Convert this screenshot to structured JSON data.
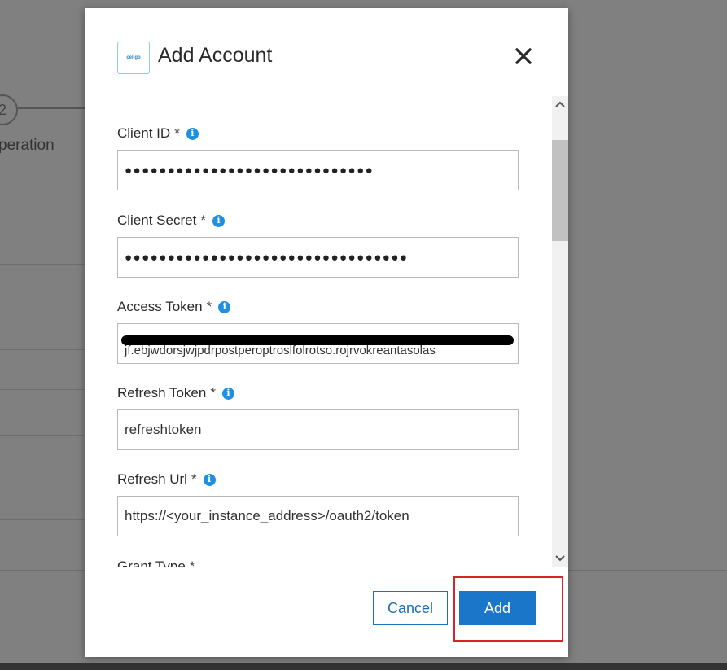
{
  "background": {
    "step_number": "2",
    "step_label": "peration"
  },
  "modal": {
    "logo_text": "celigo",
    "title": "Add Account",
    "close_icon": "close-icon",
    "fields": {
      "client_id": {
        "label": "Client ID",
        "required_mark": "*",
        "value": "●●●●●●●●●●●●●●●●●●●●●●●●●●●●●"
      },
      "client_secret": {
        "label": "Client Secret",
        "required_mark": "*",
        "value": "●●●●●●●●●●●●●●●●●●●●●●●●●●●●●●●●●"
      },
      "access_token": {
        "label": "Access Token",
        "required_mark": "*",
        "value": "jf.ebjwdorsjwjpdrpostperoptroslfolrotso.rojrvokreantasolas"
      },
      "refresh_token": {
        "label": "Refresh Token",
        "required_mark": "*",
        "value": "refreshtoken"
      },
      "refresh_url": {
        "label": "Refresh Url",
        "required_mark": "*",
        "value": "https://<your_instance_address>/oauth2/token"
      },
      "grant_type": {
        "label": "Grant Type",
        "required_mark": "*"
      }
    },
    "info_glyph": "i",
    "buttons": {
      "cancel": "Cancel",
      "add": "Add"
    }
  },
  "colors": {
    "primary": "#1976c9",
    "info_icon": "#1e8fe1",
    "highlight": "#d7232a"
  }
}
